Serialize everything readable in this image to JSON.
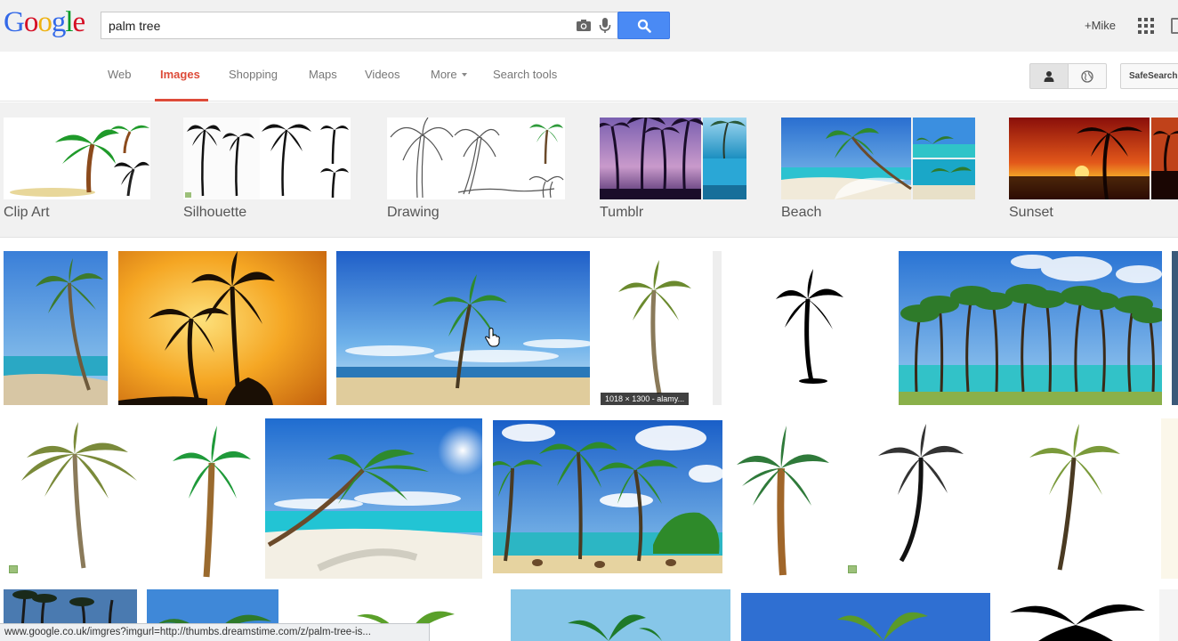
{
  "header": {
    "logo": {
      "letters": [
        "G",
        "o",
        "o",
        "g",
        "l",
        "e"
      ],
      "colors": [
        "#3369e8",
        "#d50f25",
        "#eeb211",
        "#3369e8",
        "#009925",
        "#d50f25"
      ]
    },
    "search": {
      "value": "palm tree"
    },
    "user": "+Mike"
  },
  "tabs": [
    {
      "label": "Web"
    },
    {
      "label": "Images"
    },
    {
      "label": "Shopping"
    },
    {
      "label": "Maps"
    },
    {
      "label": "Videos"
    },
    {
      "label": "More"
    },
    {
      "label": "Search tools"
    }
  ],
  "safe_search_label": "SafeSearch",
  "related": [
    {
      "label": "Clip Art"
    },
    {
      "label": "Silhouette"
    },
    {
      "label": "Drawing"
    },
    {
      "label": "Tumblr"
    },
    {
      "label": "Beach"
    },
    {
      "label": "Sunset"
    }
  ],
  "results": {
    "caption_4": "1018 × 1300 - alamy..."
  },
  "status_url": "www.google.co.uk/imgres?imgurl=http://thumbs.dreamstime.com/z/palm-tree-is...",
  "colors": {
    "accent_red": "#dd4b39",
    "search_blue": "#4a8af4",
    "sky": "#3d8ee0",
    "sea": "#2bb6c9",
    "palm_green": "#2e8b2e",
    "sunset_orange": "#f29a1b"
  }
}
